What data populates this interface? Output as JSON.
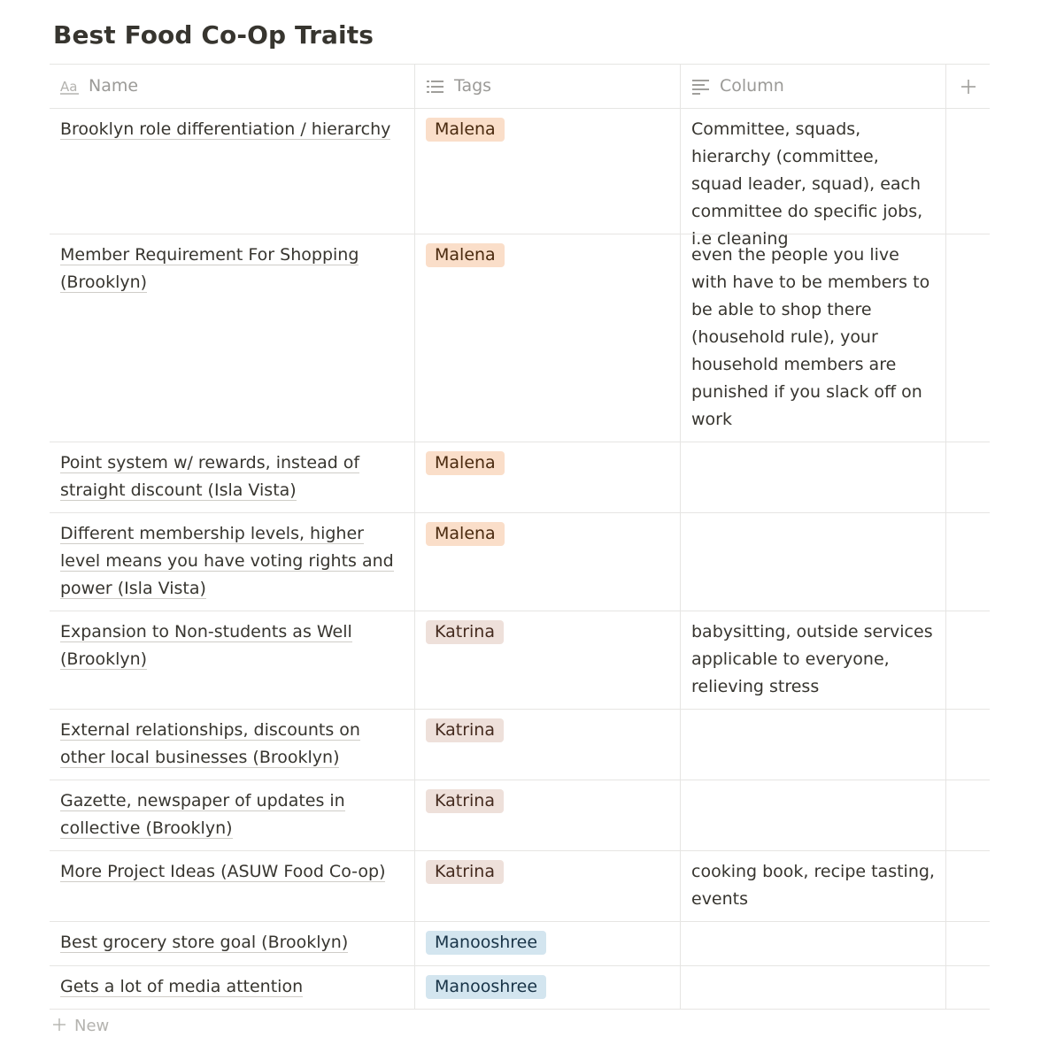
{
  "page": {
    "title": "Best Food Co-Op Traits"
  },
  "headers": {
    "name": {
      "label": "Name",
      "icon": "text-property-icon"
    },
    "tags": {
      "label": "Tags",
      "icon": "multi-select-list-icon"
    },
    "column": {
      "label": "Column",
      "icon": "text-lines-icon"
    },
    "add": {
      "label": "+",
      "icon": "plus-icon"
    }
  },
  "tag_colors": {
    "Malena": {
      "bg": "#fadec9",
      "fg": "#49290e"
    },
    "Katrina": {
      "bg": "#eee0da",
      "fg": "#442a1e"
    },
    "Manooshree": {
      "bg": "#d3e5ef",
      "fg": "#183347"
    }
  },
  "rows": [
    {
      "name": "Brooklyn role differentiation / hierarchy",
      "tag": "Malena",
      "column": "Committee, squads, hierarchy (committee, squad leader, squad), each committee do specific jobs, i.e cleaning"
    },
    {
      "name": "Member Requirement For Shopping (Brooklyn)",
      "tag": "Malena",
      "column": "even the people you live with have to be members to be able to shop there (household rule), your household members are punished if you slack off on work"
    },
    {
      "name": "Point system w/ rewards, instead of straight discount (Isla Vista)",
      "tag": "Malena",
      "column": ""
    },
    {
      "name": "Different membership levels, higher level means you have voting rights and power (Isla Vista)",
      "tag": "Malena",
      "column": ""
    },
    {
      "name": "Expansion to Non-students as Well (Brooklyn)",
      "tag": "Katrina",
      "column": "babysitting, outside services applicable to everyone, relieving stress"
    },
    {
      "name": "External relationships, discounts on other local businesses (Brooklyn)",
      "tag": "Katrina",
      "column": ""
    },
    {
      "name": "Gazette, newspaper of updates in collective (Brooklyn)",
      "tag": "Katrina",
      "column": ""
    },
    {
      "name": "More Project Ideas (ASUW Food Co-op)",
      "tag": "Katrina",
      "column": "cooking book, recipe tasting, events"
    },
    {
      "name": "Best grocery store goal (Brooklyn)",
      "tag": "Manooshree",
      "column": ""
    },
    {
      "name": "Gets a lot of media attention",
      "tag": "Manooshree",
      "column": ""
    }
  ],
  "footer": {
    "new_label": "New"
  }
}
